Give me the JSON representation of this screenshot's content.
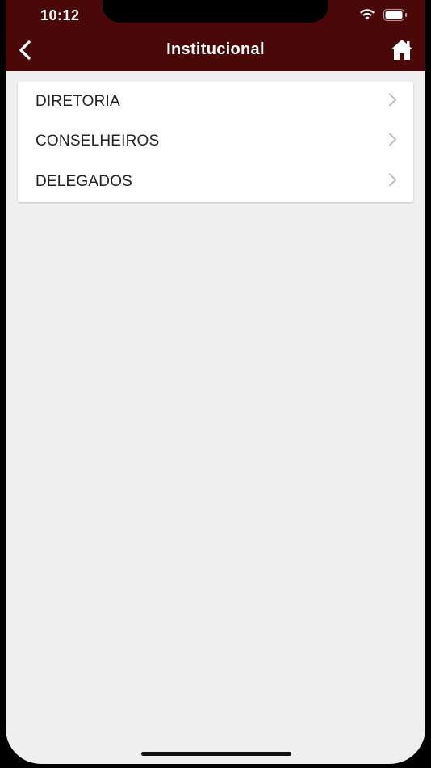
{
  "status_bar": {
    "time": "10:12"
  },
  "header": {
    "title": "Institucional",
    "background_color": "#4a0808",
    "back_icon": "chevron-left-icon",
    "home_icon": "home-icon"
  },
  "menu": {
    "items": [
      {
        "label": "DIRETORIA",
        "icon": "chevron-right-icon"
      },
      {
        "label": "CONSELHEIROS",
        "icon": "chevron-right-icon"
      },
      {
        "label": "DELEGADOS",
        "icon": "chevron-right-icon"
      }
    ]
  },
  "colors": {
    "screen_background": "#efefef",
    "card_background": "#ffffff",
    "chevron": "#bdbdbd"
  }
}
